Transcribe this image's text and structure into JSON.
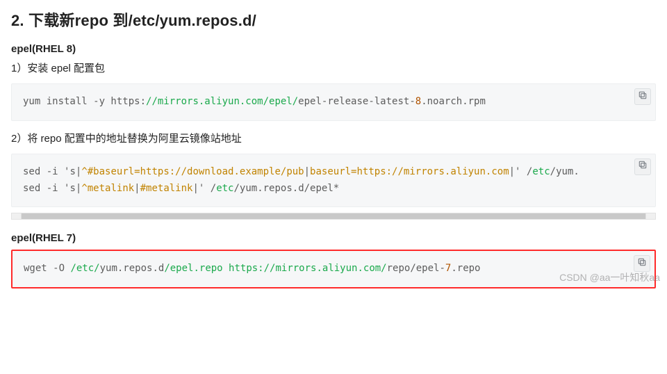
{
  "heading": "2. 下载新repo 到/etc/yum.repos.d/",
  "section1": {
    "title": "epel(RHEL 8)",
    "step1_label": "1）安装 epel 配置包",
    "code1": {
      "p1": "yum install -y https:",
      "p2": "//mirrors.aliyun.com/epel/",
      "p3": "epel-release-latest-",
      "p4": "8",
      "p5": ".noarch.rpm"
    },
    "step2_label": "2）将 repo 配置中的地址替换为阿里云镜像站地址",
    "code2_line1": {
      "p1": "sed -i ",
      "p2": "'s|",
      "p3": "^#baseurl=https://download.example/pub",
      "p4": "|",
      "p5": "baseurl=https://mirrors.aliyun.com",
      "p6": "|'",
      "p7": " /",
      "p8": "etc",
      "p9": "/yum."
    },
    "code2_line2": {
      "p1": "sed -i ",
      "p2": "'s|",
      "p3": "^metalink",
      "p4": "|",
      "p5": "#metalink",
      "p6": "|'",
      "p7": " /",
      "p8": "etc",
      "p9": "/yum.repos.d/epel*"
    }
  },
  "section2": {
    "title": "epel(RHEL 7)",
    "code": {
      "p1": "wget -O ",
      "p2": "/etc/",
      "p3": "yum.repos.d",
      "p4": "/epel.repo https://mirrors.aliyun.com/",
      "p5": "repo/epel",
      "p6": "-",
      "p7": "7",
      "p8": ".repo"
    }
  },
  "copy_label": "copy",
  "watermark": "CSDN @aa一叶知秋aa"
}
